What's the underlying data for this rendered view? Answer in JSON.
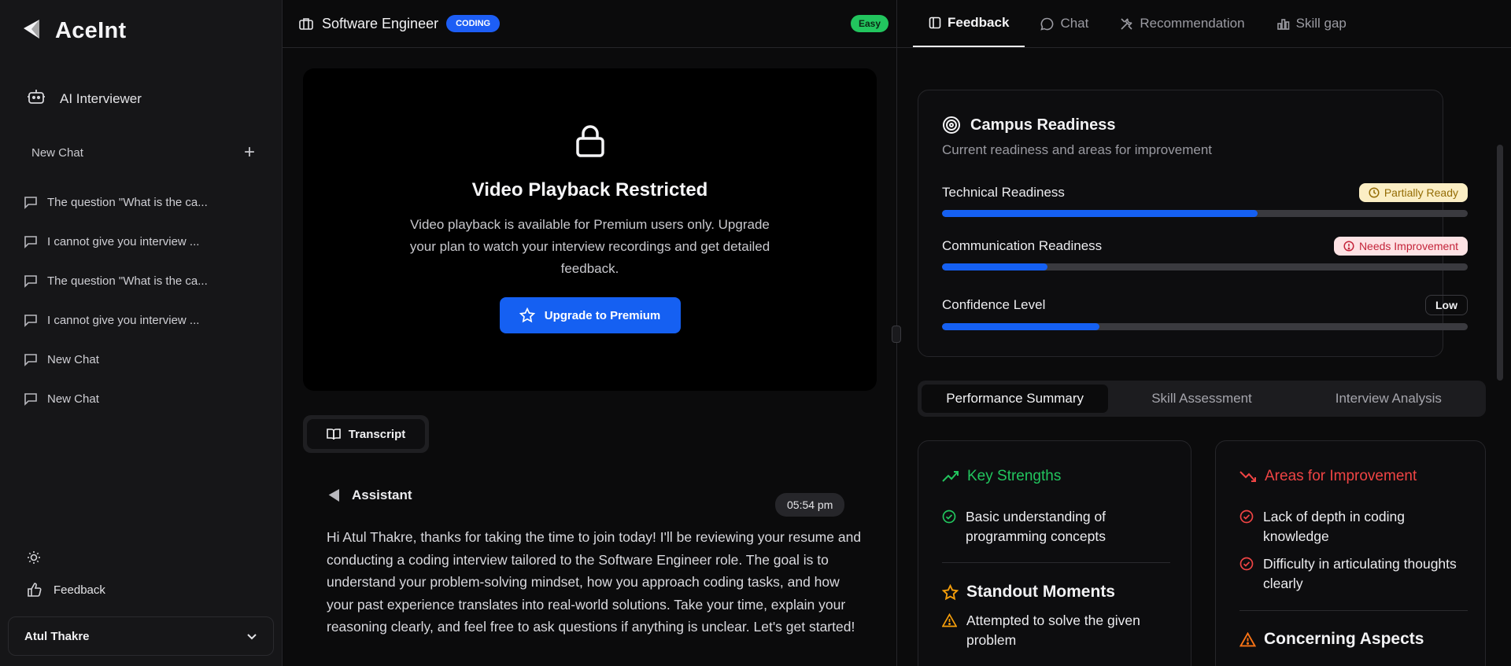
{
  "sidebar": {
    "brand": "AceInt",
    "ai_interviewer": "AI Interviewer",
    "new_chat": "New Chat",
    "chats": [
      "The question \"What is the ca...",
      "I cannot give you interview ...",
      "The question \"What is the ca...",
      "I cannot give you interview ...",
      "New Chat",
      "New Chat"
    ],
    "feedback": "Feedback",
    "user": "Atul Thakre"
  },
  "interview": {
    "title": "Software Engineer",
    "type_badge": "CODING",
    "difficulty_badge": "Easy",
    "video": {
      "title": "Video Playback Restricted",
      "desc": "Video playback is available for Premium users only. Upgrade your plan to watch your interview recordings and get detailed feedback.",
      "button": "Upgrade to Premium"
    },
    "transcript_tab": "Transcript",
    "message": {
      "role": "Assistant",
      "time": "05:54 pm",
      "text": "Hi Atul Thakre, thanks for taking the time to join today! I'll be reviewing your resume and conducting a coding interview tailored to the Software Engineer role. The goal is to understand your problem-solving mindset, how you approach coding tasks, and how your past experience translates into real-world solutions. Take your time, explain your reasoning clearly, and feel free to ask questions if anything is unclear. Let's get started!"
    }
  },
  "right": {
    "tabs": [
      "Feedback",
      "Chat",
      "Recommendation",
      "Skill gap"
    ],
    "readiness": {
      "title": "Campus Readiness",
      "subtitle": "Current readiness and areas for improvement",
      "metrics": [
        {
          "label": "Technical Readiness",
          "status": "Partially Ready",
          "value": 0.6
        },
        {
          "label": "Communication Readiness",
          "status": "Needs Improvement",
          "value": 0.2
        },
        {
          "label": "Confidence Level",
          "status": "Low",
          "value": 0.3
        }
      ]
    },
    "subtabs": [
      "Performance Summary",
      "Skill Assessment",
      "Interview Analysis"
    ],
    "strengths": {
      "title": "Key Strengths",
      "items": [
        "Basic understanding of programming concepts"
      ]
    },
    "standout": {
      "title": "Standout Moments",
      "items": [
        "Attempted to solve the given problem"
      ]
    },
    "improvement": {
      "title": "Areas for Improvement",
      "items": [
        "Lack of depth in coding knowledge",
        "Difficulty in articulating thoughts clearly"
      ]
    },
    "concerning": {
      "title": "Concerning Aspects"
    }
  },
  "colors": {
    "accent": "#1560f2",
    "success": "#22c55e",
    "danger": "#ef4444",
    "warning": "#f59e0b"
  }
}
